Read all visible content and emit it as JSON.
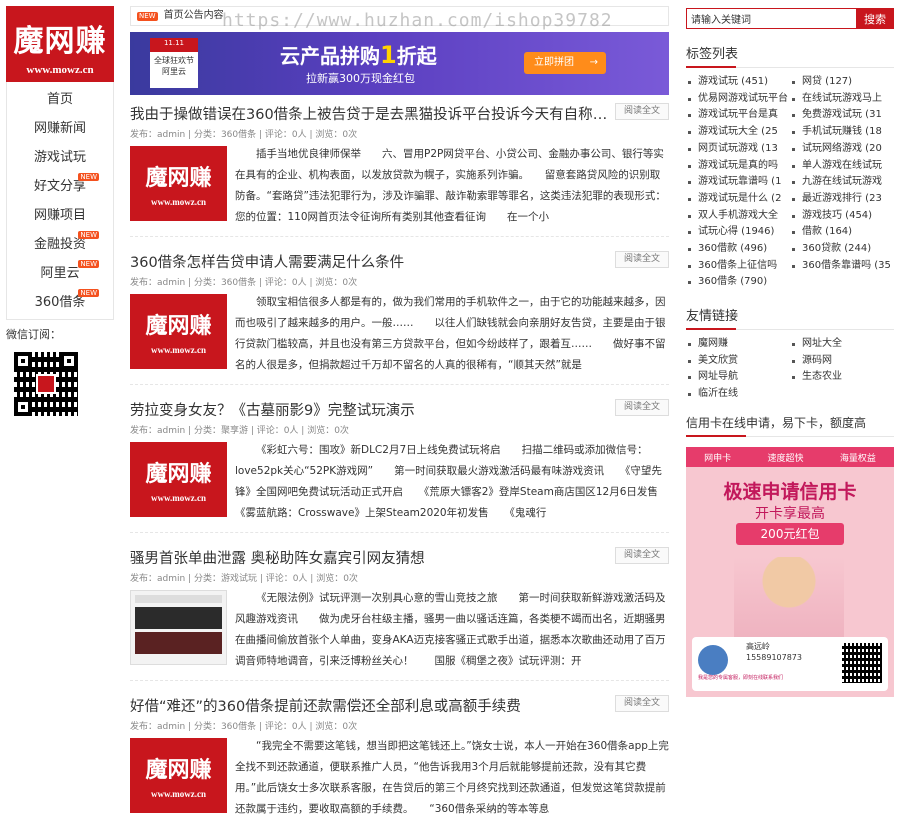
{
  "logo": {
    "title": "魔网赚",
    "url": "www.mowz.cn"
  },
  "nav": [
    {
      "label": "首页",
      "new": ""
    },
    {
      "label": "网赚新闻",
      "new": ""
    },
    {
      "label": "游戏试玩",
      "new": ""
    },
    {
      "label": "好文分享",
      "new": "NEW"
    },
    {
      "label": "网赚项目",
      "new": ""
    },
    {
      "label": "金融投资",
      "new": "NEW"
    },
    {
      "label": "阿里云",
      "new": "NEW"
    },
    {
      "label": "360借条",
      "new": "NEW"
    }
  ],
  "subscribe_label": "微信订阅：",
  "notice": {
    "tag": "NEW",
    "text": "首页公告内容"
  },
  "banner": {
    "box_top": "11.11",
    "box_sub": "全球狂欢节",
    "box_brand": "阿里云",
    "headline_a": "云产品拼购",
    "headline_num": "1",
    "headline_b": "折起",
    "sub": "拉新赢300万现金红包",
    "cta": "立即拼团",
    "cta_arrow": "→"
  },
  "watermark": "https://www.huzhan.com/ishop39782",
  "read_more": "阅读全文",
  "posts": [
    {
      "title": "我由于操做错误在360借条上被告贷于是去黑猫投诉平台投诉今天有自称360...",
      "meta": "发布：admin | 分类：360借条 | 评论：0人 | 浏览：0次",
      "thumb": "logo",
      "summary": "插手当地优良律师保举　　六、冒用P2P网贷平台、小贷公司、金融办事公司、银行等实在具有的企业、机构表面，以发放贷款为幌子，实施系列诈骗。　　留意套路贷风险的识别取防备。“套路贷”违法犯罪行为，涉及诈骗罪、敲诈勒索罪等罪名，这类违法犯罪的表现形式：　　您的位置：110网首页法令征询所有类别其他查看征询　　在一个小"
    },
    {
      "title": "360借条怎样告贷申请人需要满足什么条件",
      "meta": "发布：admin | 分类：360借条 | 评论：0人 | 浏览：0次",
      "thumb": "logo",
      "summary": "领取宝相信很多人都是有的，做为我们常用的手机软件之一，由于它的功能越来越多，因而也吸引了越来越多的用户。一般……　　以往人们缺钱就会向亲朋好友告贷，主要是由于银行贷款门槛较高，并且也没有第三方贷款平台，但如今纷歧样了，跟着互……　　做好事不留名的人很是多，但捐款超过千万却不留名的人真的很稀有，“顺其天然”就是"
    },
    {
      "title": "劳拉变身女友？《古墓丽影9》完整试玩演示",
      "meta": "发布：admin | 分类：聚享游 | 评论：0人 | 浏览：0次",
      "thumb": "logo",
      "summary": "《彩虹六号：围攻》新DLC2月7日上线免费试玩将启　　扫描二维码或添加微信号：love52pk关心“52PK游戏网”　　第一时间获取最火游戏激活码最有味游戏资讯　　《守望先锋》全国网吧免费试玩活动正式开启　　《荒原大镖客2》登岸Steam商店国区12月6日发售　　《雾蓝航路：Crosswave》上架Steam2020年初发售　　《鬼魂行"
    },
    {
      "title": "骚男首张单曲泄露 奥秘助阵女嘉宾引网友猜想",
      "meta": "发布：admin | 分类：游戏试玩 | 评论：0人 | 浏览：0次",
      "thumb": "shot",
      "summary": "《无限法例》试玩评测一次别具心意的雪山竞技之旅　　第一时间获取新鲜游戏激活码及风趣游戏资讯　　做为虎牙台柱级主播，骚男一曲以骚话连篇，各类梗不竭而出名，近期骚男在曲播间偷放首张个人单曲，变身AKA迈克接客骚正式歌手出道，据悉本次歌曲还动用了百万调音师特地调音，引来泛博粉丝关心！　　国服《稠堡之夜》试玩评测：开"
    },
    {
      "title": "好借“难还”的360借条提前还款需偿还全部利息或高额手续费",
      "meta": "发布：admin | 分类：360借条 | 评论：0人 | 浏览：0次",
      "thumb": "logo",
      "summary": "“我完全不需要这笔钱，想当即把这笔钱还上。”饶女士说，本人一开始在360借条app上完全找不到还款通道，便联系推广人员，“他告诉我用3个月后就能够提前还款，没有其它费用。”此后饶女士多次联系客服，在告贷后的第三个月终究找到还款通道，但发觉这笔贷款提前还款属于违约，要收取高额的手续费。　　“360借条采纳的等本等息"
    }
  ],
  "search": {
    "placeholder": "请输入关键词",
    "button": "搜索"
  },
  "tags_title": "标签列表",
  "tags": [
    "游戏试玩 (451)",
    "网贷 (127)",
    "优易网游戏试玩平台",
    "在线试玩游戏马上",
    "游戏试玩平台是真",
    "免费游戏试玩 (31",
    "游戏试玩大全 (25",
    "手机试玩赚钱 (18",
    "网页试玩游戏 (13",
    "试玩网络游戏 (20",
    "游戏试玩是真的吗",
    "单人游戏在线试玩",
    "游戏试玩靠谱吗 (1",
    "九游在线试玩游戏",
    "游戏试玩是什么 (2",
    "最近游戏排行 (23",
    "双人手机游戏大全",
    "游戏技巧 (454)",
    "试玩心得 (1946)",
    "借款 (164)",
    "360借款 (496)",
    "360贷款 (244)",
    "360借条上征信吗",
    "360借条靠谱吗 (35",
    "360借条 (790)",
    ""
  ],
  "links_title": "友情链接",
  "links": [
    "魔网赚",
    "网址大全",
    "美文欣赏",
    "源码网",
    "网址导航",
    "生态农业",
    "临沂在线",
    ""
  ],
  "ad_title": "信用卡在线申请，易下卡，额度高",
  "ad": {
    "bar_items": [
      "网申卡",
      "速度超快",
      "海量权益"
    ],
    "headline": "极速申请信用卡",
    "sub": "开卡享最高",
    "bonus": "200元红包",
    "name": "高远岭",
    "phone": "15589107873",
    "desc": "我是您的专属客服，即刻在线联系我们"
  },
  "colors": {
    "brand_red": "#c8161d",
    "new_tag": "#f4511e"
  }
}
